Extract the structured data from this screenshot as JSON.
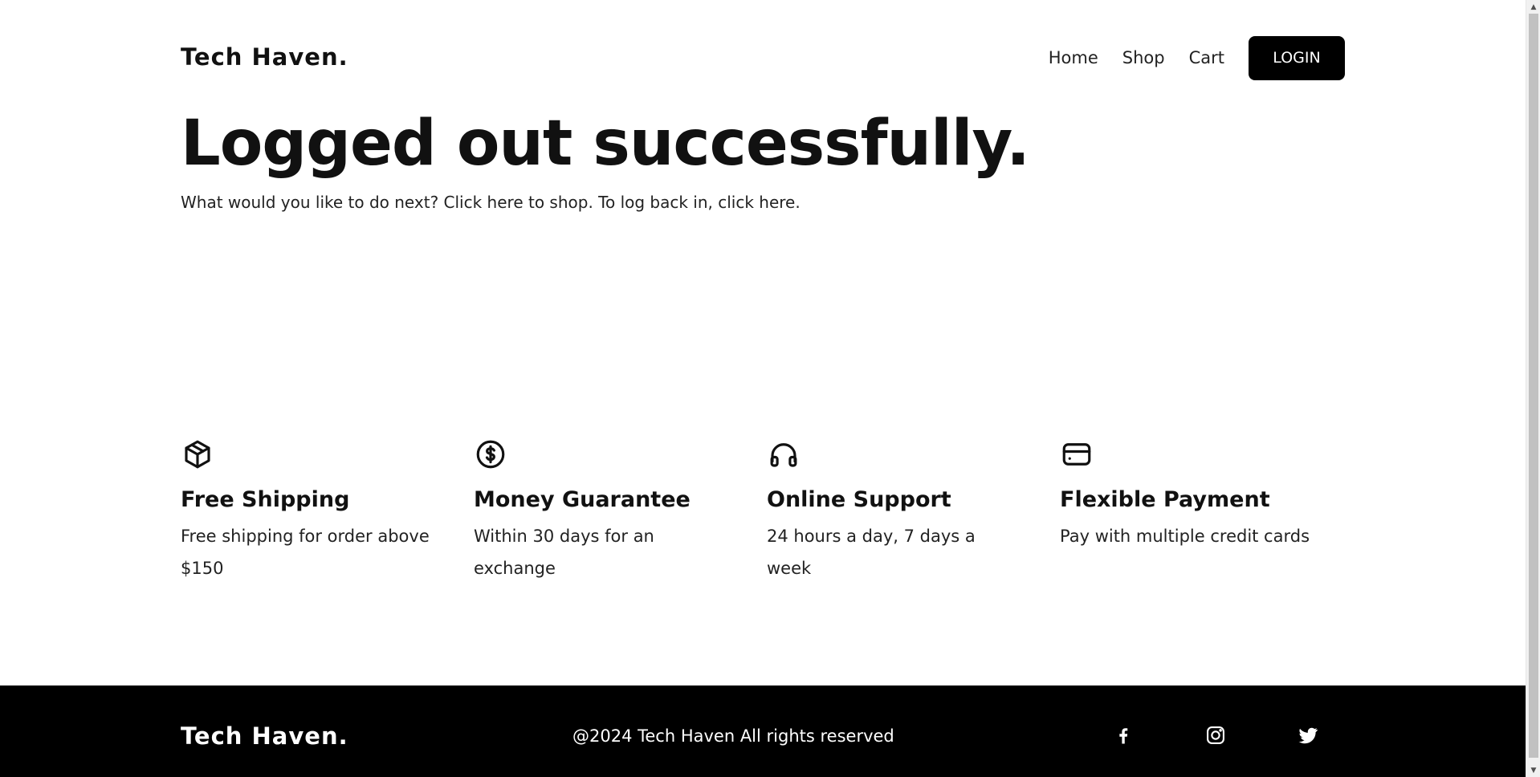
{
  "header": {
    "logo": "Tech Haven.",
    "nav": {
      "home": "Home",
      "shop": "Shop",
      "cart": "Cart",
      "login": "LOGIN"
    }
  },
  "hero": {
    "title": "Logged out successfully.",
    "subtitle": "What would you like to do next? Click here to shop. To log back in, click here."
  },
  "features": [
    {
      "icon": "package-icon",
      "title": "Free Shipping",
      "text": "Free shipping for order above $150"
    },
    {
      "icon": "dollar-coin-icon",
      "title": "Money Guarantee",
      "text": "Within 30 days for an exchange"
    },
    {
      "icon": "headphones-icon",
      "title": "Online Support",
      "text": "24 hours a day, 7 days a week"
    },
    {
      "icon": "credit-card-icon",
      "title": "Flexible Payment",
      "text": "Pay with multiple credit cards"
    }
  ],
  "footer": {
    "logo": "Tech Haven.",
    "copyright": "@2024 Tech Haven All rights reserved",
    "social": [
      "facebook-icon",
      "instagram-icon",
      "twitter-icon"
    ]
  },
  "colors": {
    "primary": "#000000",
    "text": "#111111",
    "background": "#ffffff"
  }
}
